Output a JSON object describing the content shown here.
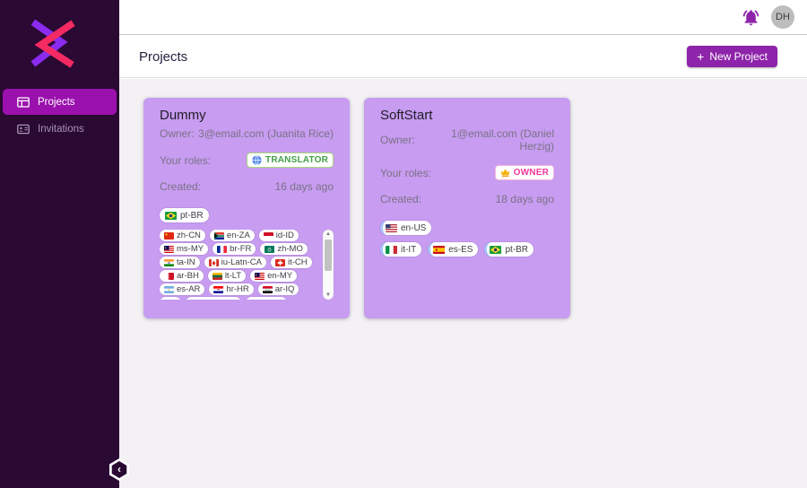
{
  "topbar": {
    "avatar_initials": "DH",
    "bell_icon": "notification-bell-icon"
  },
  "sidebar": {
    "items": [
      {
        "label": "Projects",
        "icon": "window-grid-icon",
        "active": true
      },
      {
        "label": "Invitations",
        "icon": "contact-card-icon",
        "active": false
      }
    ]
  },
  "header": {
    "title": "Projects",
    "plus_icon": "+",
    "new_project_button": "New Project"
  },
  "card_labels": {
    "owner": "Owner:",
    "roles": "Your roles:",
    "created": "Created:"
  },
  "projects": [
    {
      "name": "Dummy",
      "owner": "3@email.com (Juanita Rice)",
      "role": {
        "label": "TRANSLATOR",
        "icon": "globe-icon",
        "style": "translator"
      },
      "created": "16 days ago",
      "base_language": {
        "flag": "br",
        "label": "pt-BR"
      },
      "languages": [
        {
          "flag": "cn",
          "label": "zh-CN"
        },
        {
          "flag": "za",
          "label": "en-ZA"
        },
        {
          "flag": "id",
          "label": "id-ID"
        },
        {
          "flag": "my",
          "label": "ms-MY"
        },
        {
          "flag": "fr",
          "label": "br-FR"
        },
        {
          "flag": "mo",
          "label": "zh-MO"
        },
        {
          "flag": "in",
          "label": "ta-IN"
        },
        {
          "flag": "ca",
          "label": "iu-Latn-CA"
        },
        {
          "flag": "ch",
          "label": "it-CH"
        },
        {
          "flag": "bh",
          "label": "ar-BH"
        },
        {
          "flag": "lt",
          "label": "lt-LT"
        },
        {
          "flag": "my",
          "label": "en-MY"
        },
        {
          "flag": "ar",
          "label": "es-AR"
        },
        {
          "flag": "hr",
          "label": "hr-HR"
        },
        {
          "flag": "iq",
          "label": "ar-IQ"
        }
      ],
      "scrollable": true,
      "partially_visible_chip_widths": [
        24,
        62,
        46
      ],
      "chip_accent": false
    },
    {
      "name": "SoftStart",
      "owner": "1@email.com (Daniel Herzig)",
      "role": {
        "label": "OWNER",
        "icon": "crown-icon",
        "style": "owner"
      },
      "created": "18 days ago",
      "base_language": {
        "flag": "us",
        "label": "en-US"
      },
      "languages": [
        {
          "flag": "it",
          "label": "it-IT"
        },
        {
          "flag": "es",
          "label": "es-ES"
        },
        {
          "flag": "br",
          "label": "pt-BR"
        }
      ],
      "scrollable": false,
      "partially_visible_chip_widths": [],
      "chip_accent": true
    }
  ],
  "collapse_button": {
    "icon": "chevron-left-icon",
    "glyph": "‹"
  },
  "colors": {
    "sidebar_bg": "#2a0933",
    "sidebar_active": "#9b11ad",
    "primary_button": "#8e24aa",
    "card_bg": "#c79cf1",
    "translator_green": "#43a047",
    "owner_pink": "#f03a9c",
    "chip_accent_blue": "#a9c6f9",
    "logo_purple": "#8b2bf0",
    "logo_pink": "#f42a63"
  }
}
